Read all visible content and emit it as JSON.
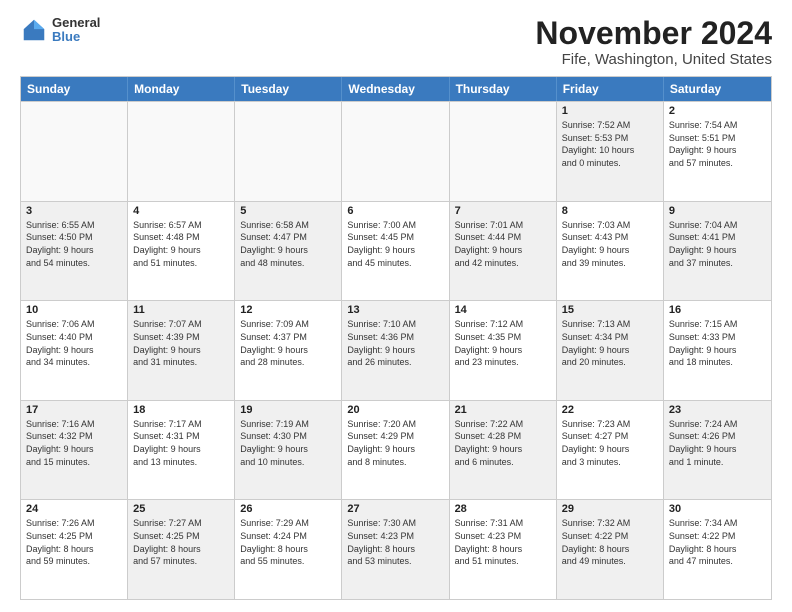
{
  "logo": {
    "general": "General",
    "blue": "Blue"
  },
  "title": "November 2024",
  "subtitle": "Fife, Washington, United States",
  "header_days": [
    "Sunday",
    "Monday",
    "Tuesday",
    "Wednesday",
    "Thursday",
    "Friday",
    "Saturday"
  ],
  "rows": [
    [
      {
        "day": "",
        "text": "",
        "empty": true
      },
      {
        "day": "",
        "text": "",
        "empty": true
      },
      {
        "day": "",
        "text": "",
        "empty": true
      },
      {
        "day": "",
        "text": "",
        "empty": true
      },
      {
        "day": "",
        "text": "",
        "empty": true
      },
      {
        "day": "1",
        "text": "Sunrise: 7:52 AM\nSunset: 5:53 PM\nDaylight: 10 hours\nand 0 minutes.",
        "empty": false,
        "shaded": true
      },
      {
        "day": "2",
        "text": "Sunrise: 7:54 AM\nSunset: 5:51 PM\nDaylight: 9 hours\nand 57 minutes.",
        "empty": false,
        "shaded": false
      }
    ],
    [
      {
        "day": "3",
        "text": "Sunrise: 6:55 AM\nSunset: 4:50 PM\nDaylight: 9 hours\nand 54 minutes.",
        "empty": false,
        "shaded": true
      },
      {
        "day": "4",
        "text": "Sunrise: 6:57 AM\nSunset: 4:48 PM\nDaylight: 9 hours\nand 51 minutes.",
        "empty": false,
        "shaded": false
      },
      {
        "day": "5",
        "text": "Sunrise: 6:58 AM\nSunset: 4:47 PM\nDaylight: 9 hours\nand 48 minutes.",
        "empty": false,
        "shaded": true
      },
      {
        "day": "6",
        "text": "Sunrise: 7:00 AM\nSunset: 4:45 PM\nDaylight: 9 hours\nand 45 minutes.",
        "empty": false,
        "shaded": false
      },
      {
        "day": "7",
        "text": "Sunrise: 7:01 AM\nSunset: 4:44 PM\nDaylight: 9 hours\nand 42 minutes.",
        "empty": false,
        "shaded": true
      },
      {
        "day": "8",
        "text": "Sunrise: 7:03 AM\nSunset: 4:43 PM\nDaylight: 9 hours\nand 39 minutes.",
        "empty": false,
        "shaded": false
      },
      {
        "day": "9",
        "text": "Sunrise: 7:04 AM\nSunset: 4:41 PM\nDaylight: 9 hours\nand 37 minutes.",
        "empty": false,
        "shaded": true
      }
    ],
    [
      {
        "day": "10",
        "text": "Sunrise: 7:06 AM\nSunset: 4:40 PM\nDaylight: 9 hours\nand 34 minutes.",
        "empty": false,
        "shaded": false
      },
      {
        "day": "11",
        "text": "Sunrise: 7:07 AM\nSunset: 4:39 PM\nDaylight: 9 hours\nand 31 minutes.",
        "empty": false,
        "shaded": true
      },
      {
        "day": "12",
        "text": "Sunrise: 7:09 AM\nSunset: 4:37 PM\nDaylight: 9 hours\nand 28 minutes.",
        "empty": false,
        "shaded": false
      },
      {
        "day": "13",
        "text": "Sunrise: 7:10 AM\nSunset: 4:36 PM\nDaylight: 9 hours\nand 26 minutes.",
        "empty": false,
        "shaded": true
      },
      {
        "day": "14",
        "text": "Sunrise: 7:12 AM\nSunset: 4:35 PM\nDaylight: 9 hours\nand 23 minutes.",
        "empty": false,
        "shaded": false
      },
      {
        "day": "15",
        "text": "Sunrise: 7:13 AM\nSunset: 4:34 PM\nDaylight: 9 hours\nand 20 minutes.",
        "empty": false,
        "shaded": true
      },
      {
        "day": "16",
        "text": "Sunrise: 7:15 AM\nSunset: 4:33 PM\nDaylight: 9 hours\nand 18 minutes.",
        "empty": false,
        "shaded": false
      }
    ],
    [
      {
        "day": "17",
        "text": "Sunrise: 7:16 AM\nSunset: 4:32 PM\nDaylight: 9 hours\nand 15 minutes.",
        "empty": false,
        "shaded": true
      },
      {
        "day": "18",
        "text": "Sunrise: 7:17 AM\nSunset: 4:31 PM\nDaylight: 9 hours\nand 13 minutes.",
        "empty": false,
        "shaded": false
      },
      {
        "day": "19",
        "text": "Sunrise: 7:19 AM\nSunset: 4:30 PM\nDaylight: 9 hours\nand 10 minutes.",
        "empty": false,
        "shaded": true
      },
      {
        "day": "20",
        "text": "Sunrise: 7:20 AM\nSunset: 4:29 PM\nDaylight: 9 hours\nand 8 minutes.",
        "empty": false,
        "shaded": false
      },
      {
        "day": "21",
        "text": "Sunrise: 7:22 AM\nSunset: 4:28 PM\nDaylight: 9 hours\nand 6 minutes.",
        "empty": false,
        "shaded": true
      },
      {
        "day": "22",
        "text": "Sunrise: 7:23 AM\nSunset: 4:27 PM\nDaylight: 9 hours\nand 3 minutes.",
        "empty": false,
        "shaded": false
      },
      {
        "day": "23",
        "text": "Sunrise: 7:24 AM\nSunset: 4:26 PM\nDaylight: 9 hours\nand 1 minute.",
        "empty": false,
        "shaded": true
      }
    ],
    [
      {
        "day": "24",
        "text": "Sunrise: 7:26 AM\nSunset: 4:25 PM\nDaylight: 8 hours\nand 59 minutes.",
        "empty": false,
        "shaded": false
      },
      {
        "day": "25",
        "text": "Sunrise: 7:27 AM\nSunset: 4:25 PM\nDaylight: 8 hours\nand 57 minutes.",
        "empty": false,
        "shaded": true
      },
      {
        "day": "26",
        "text": "Sunrise: 7:29 AM\nSunset: 4:24 PM\nDaylight: 8 hours\nand 55 minutes.",
        "empty": false,
        "shaded": false
      },
      {
        "day": "27",
        "text": "Sunrise: 7:30 AM\nSunset: 4:23 PM\nDaylight: 8 hours\nand 53 minutes.",
        "empty": false,
        "shaded": true
      },
      {
        "day": "28",
        "text": "Sunrise: 7:31 AM\nSunset: 4:23 PM\nDaylight: 8 hours\nand 51 minutes.",
        "empty": false,
        "shaded": false
      },
      {
        "day": "29",
        "text": "Sunrise: 7:32 AM\nSunset: 4:22 PM\nDaylight: 8 hours\nand 49 minutes.",
        "empty": false,
        "shaded": true
      },
      {
        "day": "30",
        "text": "Sunrise: 7:34 AM\nSunset: 4:22 PM\nDaylight: 8 hours\nand 47 minutes.",
        "empty": false,
        "shaded": false
      }
    ]
  ]
}
